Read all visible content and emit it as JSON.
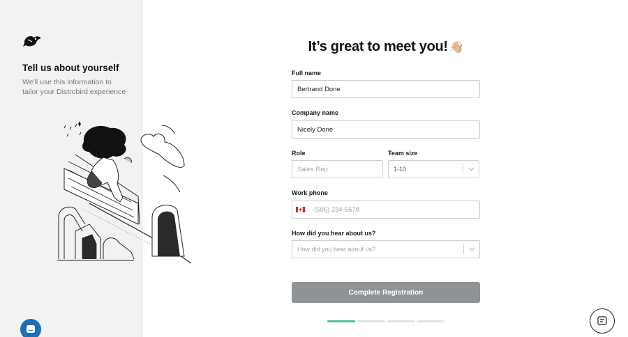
{
  "sidebar": {
    "title": "Tell us about yourself",
    "description": "We'll use this information to tailor your Distrobird experience"
  },
  "main": {
    "heading": "It’s great to meet you!",
    "heading_emoji": "👋🏼"
  },
  "form": {
    "full_name": {
      "label": "Full name",
      "value": "Bertrand Done"
    },
    "company_name": {
      "label": "Company name",
      "value": "Nicely Done"
    },
    "role": {
      "label": "Role",
      "placeholder": "Sales Rep."
    },
    "team_size": {
      "label": "Team size",
      "value": "1-10"
    },
    "work_phone": {
      "label": "Work phone",
      "country": "CA",
      "placeholder": "(506) 234-5678"
    },
    "referral": {
      "label": "How did you hear about us?",
      "placeholder": "How did you hear about us?"
    },
    "submit_label": "Complete Registration"
  },
  "progress": {
    "current_step": 1,
    "total_steps": 4
  },
  "colors": {
    "accent": "#4fc08d",
    "button_disabled": "#909396",
    "sidebar_bg": "#f2f2f2",
    "chat_launcher": "#1e6fb4"
  },
  "icons": {
    "logo": "bird-logo-icon",
    "chat": "chat-bubble-icon",
    "help": "message-lines-icon",
    "dropdown": "chevron-down-icon",
    "flag": "canada-flag-icon"
  }
}
